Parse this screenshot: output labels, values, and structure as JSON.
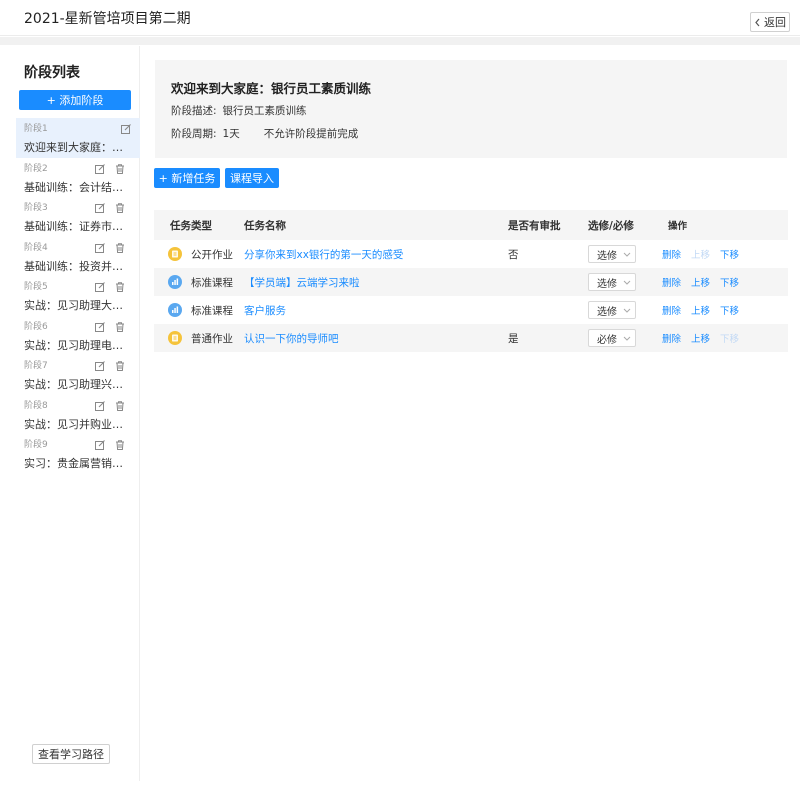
{
  "app": {
    "title": "2021-星新管培项目第二期",
    "back_label": "返回"
  },
  "sidebar": {
    "title": "阶段列表",
    "add_stage_label": "+ 添加阶段",
    "view_path_label": "查看学习路径",
    "stages": [
      {
        "no": "阶段1",
        "name": "欢迎来到大家庭：银行员工素质训练",
        "active": true
      },
      {
        "no": "阶段2",
        "name": "基础训练：会计结算部门",
        "active": false
      },
      {
        "no": "阶段3",
        "name": "基础训练：证券市场投资",
        "active": false
      },
      {
        "no": "阶段4",
        "name": "基础训练：投资并购知识",
        "active": false
      },
      {
        "no": "阶段5",
        "name": "实战：见习助理大堂经理",
        "active": false
      },
      {
        "no": "阶段6",
        "name": "实战：见习助理电话营销",
        "active": false
      },
      {
        "no": "阶段7",
        "name": "实战：见习助理兴业惠民",
        "active": false
      },
      {
        "no": "阶段8",
        "name": "实战：见习并购业务营销",
        "active": false
      },
      {
        "no": "阶段9",
        "name": "实习：贵金属营销助理",
        "active": false
      }
    ]
  },
  "stage_info": {
    "welcome": "欢迎来到大家庭：银行员工素质训练",
    "desc_label": "阶段描述:",
    "desc_value": "银行员工素质训练",
    "period_label": "阶段周期:",
    "period_value": "1天",
    "period_note": "不允许阶段提前完成"
  },
  "actions": {
    "add_task_label": "+ 新增任务",
    "import_label": "课程导入"
  },
  "table": {
    "headers": {
      "type": "任务类型",
      "name": "任务名称",
      "approve": "是否有审批",
      "select": "选修/必修",
      "ops": "操作"
    },
    "rows": [
      {
        "type": "公开作业",
        "icon": "homework-icon",
        "icon_color": "#f5c33b",
        "name": "分享你来到xx银行的第一天的感受",
        "approve": "否",
        "select": "选修",
        "ops": [
          "删除",
          "上移",
          "下移"
        ],
        "disabled_ops": [
          "上移"
        ]
      },
      {
        "type": "标准课程",
        "icon": "course-icon",
        "icon_color": "#5aa8f0",
        "name": "【学员端】云端学习来啦",
        "approve": "",
        "select": "选修",
        "ops": [
          "删除",
          "上移",
          "下移"
        ],
        "disabled_ops": []
      },
      {
        "type": "标准课程",
        "icon": "course-icon",
        "icon_color": "#5aa8f0",
        "name": "客户服务",
        "approve": "",
        "select": "选修",
        "ops": [
          "删除",
          "上移",
          "下移"
        ],
        "disabled_ops": []
      },
      {
        "type": "普通作业",
        "icon": "homework-icon",
        "icon_color": "#f5c33b",
        "name": "认识一下你的导师吧",
        "approve": "是",
        "select": "必修",
        "ops": [
          "删除",
          "上移",
          "下移"
        ],
        "disabled_ops": [
          "下移"
        ]
      }
    ]
  },
  "colors": {
    "primary": "#1a8cff",
    "active_bg": "#e8f1fd",
    "card_bg": "#f5f5f5"
  }
}
